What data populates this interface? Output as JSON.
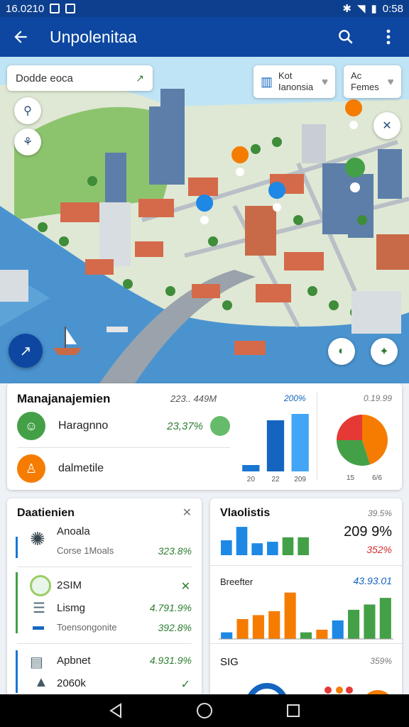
{
  "status_bar": {
    "time_left": "16.0210",
    "time_right": "0:58"
  },
  "app_bar": {
    "title": "Unpolenitaa",
    "back_icon": "arrow-left-icon",
    "search_icon": "search-icon",
    "menu_icon": "more-vert-icon"
  },
  "map": {
    "search": {
      "value": "Dodde eoca"
    },
    "chips": [
      {
        "line1": "Kot",
        "line2": "Ianonsia"
      },
      {
        "line1": "Ac",
        "line2": "Femes"
      }
    ]
  },
  "card_management": {
    "title": "Manajanajemien",
    "amount": "223.. 449M",
    "rows": [
      {
        "label": "Haragnno",
        "value": "23,37%"
      },
      {
        "label": "dalmetile"
      }
    ],
    "bar_chart_header": "200%",
    "bar_chart_labels": [
      "20",
      "22",
      "209"
    ],
    "pie_header": "0.19.99",
    "pie_labels": [
      "15",
      "6/6"
    ]
  },
  "card_dataset": {
    "title": "Daatienien",
    "entries": [
      {
        "label": "Anoala",
        "sub": "Corse 1Moals",
        "value": "323.8%"
      },
      {
        "label": "2SIM",
        "sub": "",
        "value": ""
      },
      {
        "label": "Lismg",
        "sub": "Toensongonite",
        "value": "4.791.9%"
      },
      {
        "label": "",
        "sub": "",
        "value": "392.8%"
      },
      {
        "label": "Apbnet",
        "sub": "",
        "value": "4.931.9%"
      },
      {
        "label": "2060k",
        "sub": "",
        "value": ""
      }
    ]
  },
  "card_stats": {
    "title": "Vlaolistis",
    "small1": "39.5%",
    "big_value": "209 9%",
    "red_value": "352%",
    "section2_label": "Breefter",
    "section2_value": "43.93.01",
    "section3_label": "SIG",
    "section3_value": "359%"
  },
  "chart_data": [
    {
      "type": "bar",
      "categories": [
        "20",
        "22",
        "209"
      ],
      "values": [
        10,
        80,
        90
      ],
      "colors": [
        "#1976d2",
        "#1565c0",
        "#42a5f5"
      ]
    },
    {
      "type": "pie",
      "values": [
        45,
        30,
        25
      ],
      "colors": [
        "#f57c00",
        "#43a047",
        "#e53935"
      ]
    },
    {
      "type": "bar",
      "values": [
        20,
        38,
        16,
        18,
        24,
        24
      ],
      "colors": [
        "#1e88e5",
        "#1e88e5",
        "#1e88e5",
        "#1e88e5",
        "#43a047",
        "#43a047"
      ]
    },
    {
      "type": "bar",
      "values": [
        10,
        30,
        36,
        42,
        70,
        10,
        14,
        28,
        44,
        52,
        62
      ],
      "colors": [
        "#1e88e5",
        "#f57c00",
        "#f57c00",
        "#f57c00",
        "#f57c00",
        "#43a047",
        "#f57c00",
        "#1e88e5",
        "#43a047",
        "#43a047",
        "#43a047"
      ]
    }
  ]
}
